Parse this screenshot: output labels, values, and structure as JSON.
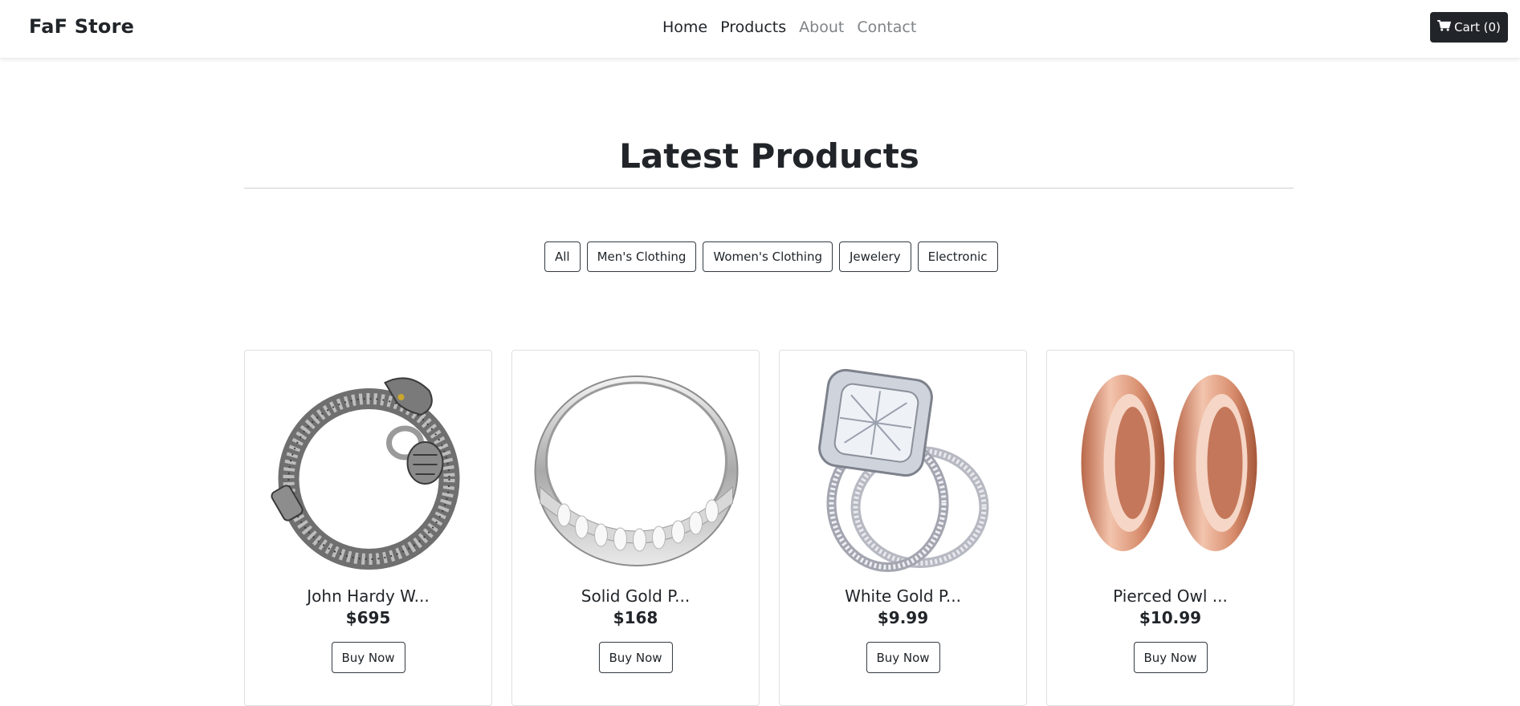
{
  "navbar": {
    "brand": "FaF Store",
    "links": [
      {
        "label": "Home",
        "state": "active"
      },
      {
        "label": "Products",
        "state": "active"
      },
      {
        "label": "About",
        "state": "muted"
      },
      {
        "label": "Contact",
        "state": "muted"
      }
    ],
    "cart_label": "Cart (0)",
    "cart_icon": "shopping-cart-icon"
  },
  "main": {
    "title": "Latest Products",
    "filters": [
      "All",
      "Men's Clothing",
      "Women's Clothing",
      "Jewelery",
      "Electronic"
    ]
  },
  "products": [
    {
      "title": "John Hardy W...",
      "price": "$695",
      "button": "Buy Now",
      "image": "silver-dragon-bracelet"
    },
    {
      "title": "Solid Gold P...",
      "price": "$168",
      "button": "Buy Now",
      "image": "silver-band-ring"
    },
    {
      "title": "White Gold P...",
      "price": "$9.99",
      "button": "Buy Now",
      "image": "diamond-engagement-ring-set"
    },
    {
      "title": "Pierced Owl ...",
      "price": "$10.99",
      "button": "Buy Now",
      "image": "rose-gold-tunnel-plugs"
    }
  ],
  "colors": {
    "dark": "#212529",
    "muted_link": "#808487",
    "divider": "#cfcfcf",
    "card_border": "#e0e0e0"
  }
}
